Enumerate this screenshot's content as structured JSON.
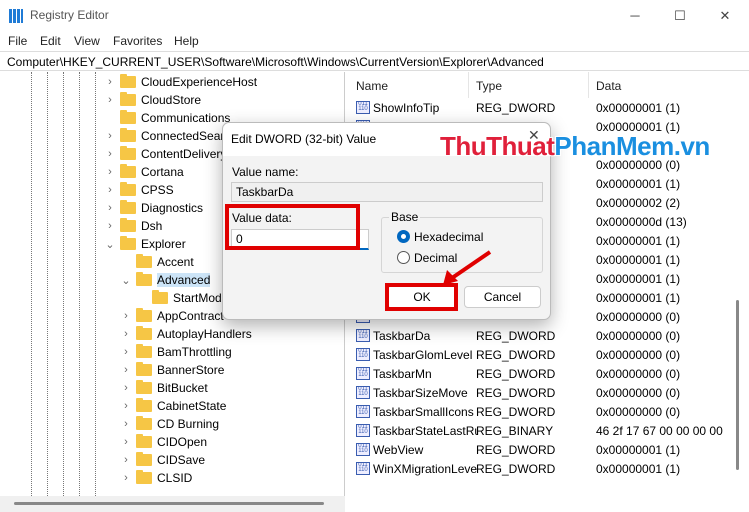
{
  "window": {
    "title": "Registry Editor",
    "minimize": "─",
    "maximize": "☐",
    "close": "✕"
  },
  "menu": [
    "File",
    "Edit",
    "View",
    "Favorites",
    "Help"
  ],
  "address": "Computer\\HKEY_CURRENT_USER\\Software\\Microsoft\\Windows\\CurrentVersion\\Explorer\\Advanced",
  "tree": [
    {
      "label": "CloudExperienceHost",
      "level": 1,
      "chev": ">"
    },
    {
      "label": "CloudStore",
      "level": 1,
      "chev": ">"
    },
    {
      "label": "Communications",
      "level": 1,
      "chev": ""
    },
    {
      "label": "ConnectedSearch",
      "level": 1,
      "chev": ">"
    },
    {
      "label": "ContentDeliveryManager",
      "level": 1,
      "chev": ">"
    },
    {
      "label": "Cortana",
      "level": 1,
      "chev": ">"
    },
    {
      "label": "CPSS",
      "level": 1,
      "chev": ">"
    },
    {
      "label": "Diagnostics",
      "level": 1,
      "chev": ">"
    },
    {
      "label": "Dsh",
      "level": 1,
      "chev": ">"
    },
    {
      "label": "Explorer",
      "level": 1,
      "chev": "v"
    },
    {
      "label": "Accent",
      "level": 2,
      "chev": ""
    },
    {
      "label": "Advanced",
      "level": 2,
      "chev": "v",
      "selected": true
    },
    {
      "label": "StartMode",
      "level": 3,
      "chev": ""
    },
    {
      "label": "AppContract",
      "level": 2,
      "chev": ">"
    },
    {
      "label": "AutoplayHandlers",
      "level": 2,
      "chev": ">"
    },
    {
      "label": "BamThrottling",
      "level": 2,
      "chev": ">"
    },
    {
      "label": "BannerStore",
      "level": 2,
      "chev": ">"
    },
    {
      "label": "BitBucket",
      "level": 2,
      "chev": ">"
    },
    {
      "label": "CabinetState",
      "level": 2,
      "chev": ">"
    },
    {
      "label": "CD Burning",
      "level": 2,
      "chev": ">"
    },
    {
      "label": "CIDOpen",
      "level": 2,
      "chev": ">"
    },
    {
      "label": "CIDSave",
      "level": 2,
      "chev": ">"
    },
    {
      "label": "CLSID",
      "level": 2,
      "chev": ">"
    }
  ],
  "columns": {
    "name": "Name",
    "type": "Type",
    "data": "Data"
  },
  "values": [
    {
      "name": "ShowInfoTip",
      "type": "REG_DWORD",
      "data": "0x00000001 (1)"
    },
    {
      "name": "",
      "type": "",
      "data": "0x00000001 (1)"
    },
    {
      "name": "",
      "type": "",
      "data": ""
    },
    {
      "name": "",
      "type": "",
      "data": "0x00000000 (0)"
    },
    {
      "name": "",
      "type": "",
      "data": "0x00000001 (1)"
    },
    {
      "name": "",
      "type": "",
      "data": "0x00000002 (2)"
    },
    {
      "name": "",
      "type": "",
      "data": "0x0000000d (13)"
    },
    {
      "name": "",
      "type": "",
      "data": "0x00000001 (1)"
    },
    {
      "name": "",
      "type": "",
      "data": "0x00000001 (1)"
    },
    {
      "name": "",
      "type": "",
      "data": "0x00000001 (1)"
    },
    {
      "name": "",
      "type": "",
      "data": "0x00000001 (1)"
    },
    {
      "name": "",
      "type": "",
      "data": "0x00000000 (0)"
    },
    {
      "name": "TaskbarDa",
      "type": "REG_DWORD",
      "data": "0x00000000 (0)"
    },
    {
      "name": "TaskbarGlomLevel",
      "type": "REG_DWORD",
      "data": "0x00000000 (0)"
    },
    {
      "name": "TaskbarMn",
      "type": "REG_DWORD",
      "data": "0x00000000 (0)"
    },
    {
      "name": "TaskbarSizeMove",
      "type": "REG_DWORD",
      "data": "0x00000000 (0)"
    },
    {
      "name": "TaskbarSmallIcons",
      "type": "REG_DWORD",
      "data": "0x00000000 (0)"
    },
    {
      "name": "TaskbarStateLastRun",
      "type": "REG_BINARY",
      "data": "46 2f 17 67 00 00 00 00"
    },
    {
      "name": "WebView",
      "type": "REG_DWORD",
      "data": "0x00000001 (1)"
    },
    {
      "name": "WinXMigrationLevel",
      "type": "REG_DWORD",
      "data": "0x00000001 (1)"
    }
  ],
  "dialog": {
    "title": "Edit DWORD (32-bit) Value",
    "close": "✕",
    "value_name_label": "Value name:",
    "value_name": "TaskbarDa",
    "value_data_label": "Value data:",
    "value_data": "0",
    "base_label": "Base",
    "hex_label": "Hexadecimal",
    "dec_label": "Decimal",
    "base_selected": "Hexadecimal",
    "ok": "OK",
    "cancel": "Cancel"
  },
  "watermark": {
    "part1": "ThuThuat",
    "part2": "PhanMem.vn",
    "color1": "#e0203a",
    "color2": "#1a8fe0"
  },
  "highlight_color": "#e00000"
}
